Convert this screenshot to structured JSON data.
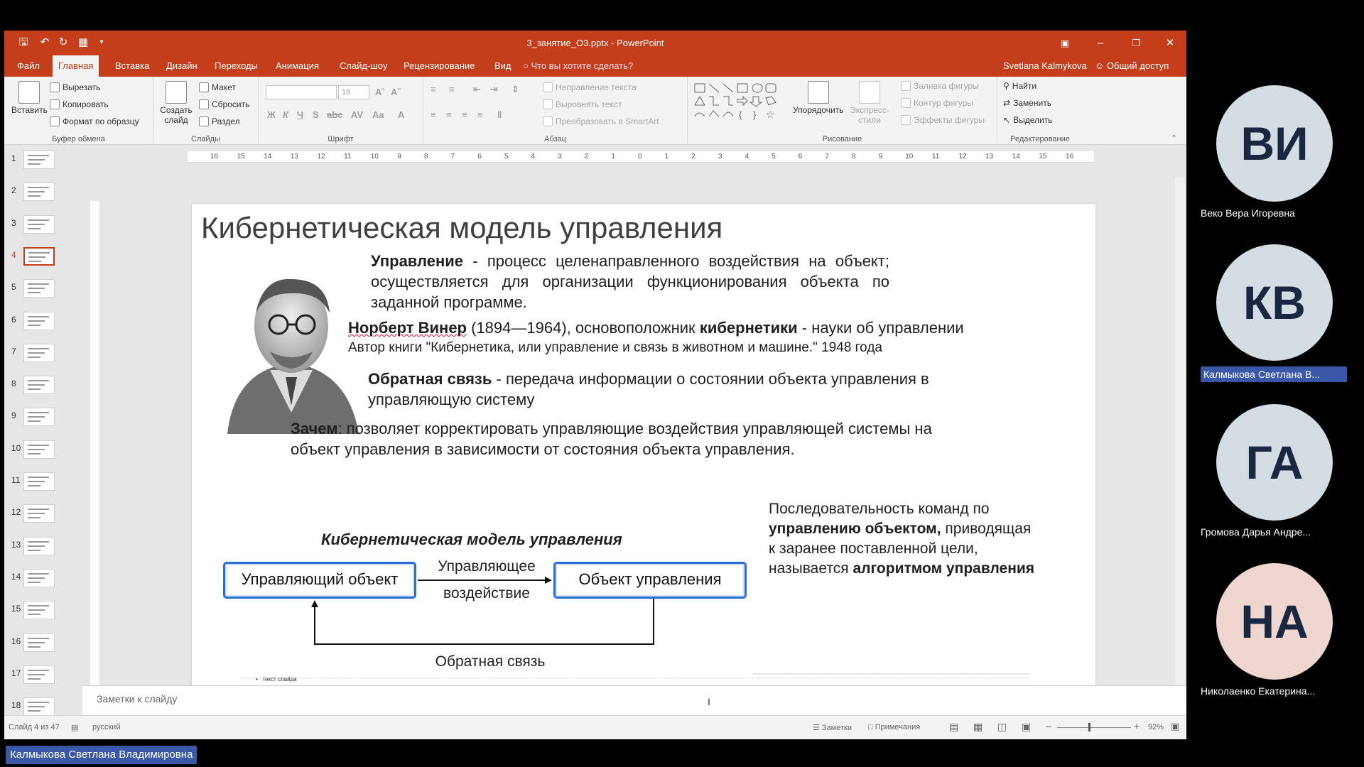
{
  "window": {
    "title": "3_занятие_О3.pptx - PowerPoint",
    "user": "Svetlana Kalmykova",
    "share": "Общий доступ"
  },
  "tabs": [
    {
      "label": "Файл"
    },
    {
      "label": "Главная"
    },
    {
      "label": "Вставка"
    },
    {
      "label": "Дизайн"
    },
    {
      "label": "Переходы"
    },
    {
      "label": "Анимация"
    },
    {
      "label": "Слайд-шоу"
    },
    {
      "label": "Рецензирование"
    },
    {
      "label": "Вид"
    }
  ],
  "tellme": "Что вы хотите сделать?",
  "ribbon": {
    "clipboard": {
      "group": "Буфер обмена",
      "paste": "Вставить",
      "cut": "Вырезать",
      "copy": "Копировать",
      "format_painter": "Формат по образцу"
    },
    "slides": {
      "group": "Слайды",
      "new_slide": "Создать слайд",
      "layout": "Макет",
      "reset": "Сбросить",
      "section": "Раздел"
    },
    "font": {
      "group": "Шрифт",
      "size": "18"
    },
    "paragraph": {
      "group": "Абзац",
      "text_direction": "Направление текста",
      "align_text": "Выровнять текст",
      "smartart": "Преобразовать в SmartArt"
    },
    "drawing": {
      "group": "Рисование",
      "arrange": "Упорядочить",
      "quick_styles": "Экспресс-стили",
      "shape_fill": "Заливка фигуры",
      "shape_outline": "Контур фигуры",
      "shape_effects": "Эффекты фигуры"
    },
    "editing": {
      "group": "Редактирование",
      "find": "Найти",
      "replace": "Заменить",
      "select": "Выделить"
    }
  },
  "ruler": {
    "ticks": [
      "16",
      "15",
      "14",
      "13",
      "12",
      "11",
      "10",
      "9",
      "8",
      "7",
      "6",
      "5",
      "4",
      "3",
      "2",
      "1",
      "0",
      "1",
      "2",
      "3",
      "4",
      "5",
      "6",
      "7",
      "8",
      "9",
      "10",
      "11",
      "12",
      "13",
      "14",
      "15",
      "16"
    ]
  },
  "thumbnails": [
    {
      "num": "1"
    },
    {
      "num": "2"
    },
    {
      "num": "3"
    },
    {
      "num": "4"
    },
    {
      "num": "5"
    },
    {
      "num": "6"
    },
    {
      "num": "7"
    },
    {
      "num": "8"
    },
    {
      "num": "9"
    },
    {
      "num": "10"
    },
    {
      "num": "11"
    },
    {
      "num": "12"
    },
    {
      "num": "13"
    },
    {
      "num": "14"
    },
    {
      "num": "15"
    },
    {
      "num": "16"
    },
    {
      "num": "17"
    },
    {
      "num": "18"
    }
  ],
  "selected_slide_index": 4,
  "slide": {
    "title": "Кибернетическая модель управления",
    "def_term": "Управление",
    "def_text": " - процесс целенаправленного воздействия на объект; осуществляется для организации функционирования объекта по заданной программе.",
    "wiener_name": "Норберт Винер",
    "wiener_years": " (1894—1964), основоположник ",
    "wiener_cyber": "кибернетики",
    "wiener_tail": " - науки об управлении",
    "book_line": "Автор книги \"Кибернетика, или управление и связь в животном и машине.\" 1948 года",
    "feedback_term": "Обратная связь",
    "feedback_text": " - передача информации о состоянии объекта управления в управляющую систему",
    "why_term": "Зачем",
    "why_text": ": позволяет корректировать управляющие воздействия управляющей системы на объект управления в зависимости от состояния объекта управления.",
    "diagram_title": "Кибернетическая модель управления",
    "box_left": "Управляющий объект",
    "box_right": "Объект управления",
    "arrow_label_1": "Управляющее",
    "arrow_label_2": "воздействие",
    "feedback_label": "Обратная связь",
    "algo_1": "Последовательность команд по ",
    "algo_bold_1": "управлению объектом,",
    "algo_2": " приводящая к заранее поставленной цели, называется ",
    "algo_bold_2": "алгоритмом управления",
    "placeholder_text": "текст слайда"
  },
  "notes_placeholder": "Заметки к слайду",
  "status": {
    "slide_of": "Слайд 4 из 47",
    "language": "русский",
    "notes": "Заметки",
    "comments": "Примечания",
    "zoom": "92%"
  },
  "participants": [
    {
      "initials": "ВИ",
      "name": "Веко Вера Игоревна",
      "color": "#d3dde3"
    },
    {
      "initials": "КВ",
      "name": "Калмыкова Светлана В...",
      "color": "#d3dde3",
      "highlight": true
    },
    {
      "initials": "ГА",
      "name": "Громова Дарья Андре...",
      "color": "#d3dde3"
    },
    {
      "initials": "НА",
      "name": "Николаенко Екатерина...",
      "color": "#f0d6d0"
    }
  ],
  "speaker": "Калмыкова Светлана Владимировна"
}
